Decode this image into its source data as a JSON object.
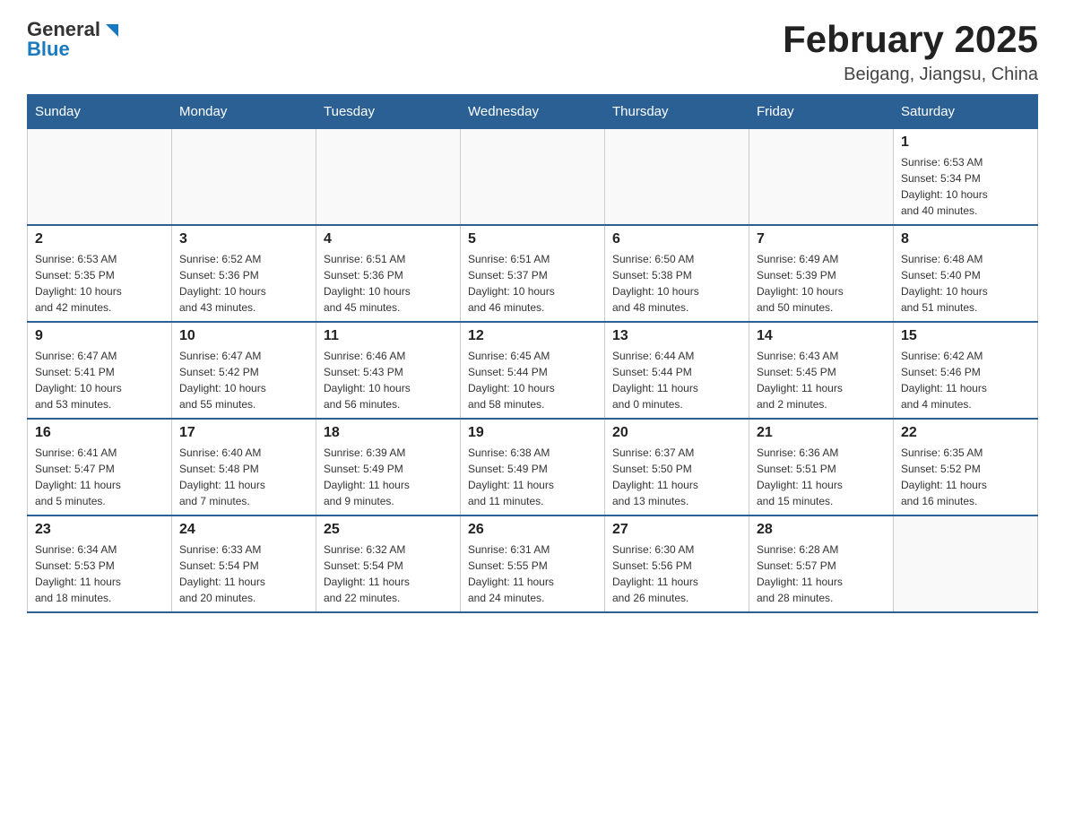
{
  "header": {
    "logo_general": "General",
    "logo_blue": "Blue",
    "month_title": "February 2025",
    "location": "Beigang, Jiangsu, China"
  },
  "days_of_week": [
    "Sunday",
    "Monday",
    "Tuesday",
    "Wednesday",
    "Thursday",
    "Friday",
    "Saturday"
  ],
  "weeks": [
    {
      "days": [
        {
          "num": "",
          "info": ""
        },
        {
          "num": "",
          "info": ""
        },
        {
          "num": "",
          "info": ""
        },
        {
          "num": "",
          "info": ""
        },
        {
          "num": "",
          "info": ""
        },
        {
          "num": "",
          "info": ""
        },
        {
          "num": "1",
          "info": "Sunrise: 6:53 AM\nSunset: 5:34 PM\nDaylight: 10 hours\nand 40 minutes."
        }
      ]
    },
    {
      "days": [
        {
          "num": "2",
          "info": "Sunrise: 6:53 AM\nSunset: 5:35 PM\nDaylight: 10 hours\nand 42 minutes."
        },
        {
          "num": "3",
          "info": "Sunrise: 6:52 AM\nSunset: 5:36 PM\nDaylight: 10 hours\nand 43 minutes."
        },
        {
          "num": "4",
          "info": "Sunrise: 6:51 AM\nSunset: 5:36 PM\nDaylight: 10 hours\nand 45 minutes."
        },
        {
          "num": "5",
          "info": "Sunrise: 6:51 AM\nSunset: 5:37 PM\nDaylight: 10 hours\nand 46 minutes."
        },
        {
          "num": "6",
          "info": "Sunrise: 6:50 AM\nSunset: 5:38 PM\nDaylight: 10 hours\nand 48 minutes."
        },
        {
          "num": "7",
          "info": "Sunrise: 6:49 AM\nSunset: 5:39 PM\nDaylight: 10 hours\nand 50 minutes."
        },
        {
          "num": "8",
          "info": "Sunrise: 6:48 AM\nSunset: 5:40 PM\nDaylight: 10 hours\nand 51 minutes."
        }
      ]
    },
    {
      "days": [
        {
          "num": "9",
          "info": "Sunrise: 6:47 AM\nSunset: 5:41 PM\nDaylight: 10 hours\nand 53 minutes."
        },
        {
          "num": "10",
          "info": "Sunrise: 6:47 AM\nSunset: 5:42 PM\nDaylight: 10 hours\nand 55 minutes."
        },
        {
          "num": "11",
          "info": "Sunrise: 6:46 AM\nSunset: 5:43 PM\nDaylight: 10 hours\nand 56 minutes."
        },
        {
          "num": "12",
          "info": "Sunrise: 6:45 AM\nSunset: 5:44 PM\nDaylight: 10 hours\nand 58 minutes."
        },
        {
          "num": "13",
          "info": "Sunrise: 6:44 AM\nSunset: 5:44 PM\nDaylight: 11 hours\nand 0 minutes."
        },
        {
          "num": "14",
          "info": "Sunrise: 6:43 AM\nSunset: 5:45 PM\nDaylight: 11 hours\nand 2 minutes."
        },
        {
          "num": "15",
          "info": "Sunrise: 6:42 AM\nSunset: 5:46 PM\nDaylight: 11 hours\nand 4 minutes."
        }
      ]
    },
    {
      "days": [
        {
          "num": "16",
          "info": "Sunrise: 6:41 AM\nSunset: 5:47 PM\nDaylight: 11 hours\nand 5 minutes."
        },
        {
          "num": "17",
          "info": "Sunrise: 6:40 AM\nSunset: 5:48 PM\nDaylight: 11 hours\nand 7 minutes."
        },
        {
          "num": "18",
          "info": "Sunrise: 6:39 AM\nSunset: 5:49 PM\nDaylight: 11 hours\nand 9 minutes."
        },
        {
          "num": "19",
          "info": "Sunrise: 6:38 AM\nSunset: 5:49 PM\nDaylight: 11 hours\nand 11 minutes."
        },
        {
          "num": "20",
          "info": "Sunrise: 6:37 AM\nSunset: 5:50 PM\nDaylight: 11 hours\nand 13 minutes."
        },
        {
          "num": "21",
          "info": "Sunrise: 6:36 AM\nSunset: 5:51 PM\nDaylight: 11 hours\nand 15 minutes."
        },
        {
          "num": "22",
          "info": "Sunrise: 6:35 AM\nSunset: 5:52 PM\nDaylight: 11 hours\nand 16 minutes."
        }
      ]
    },
    {
      "days": [
        {
          "num": "23",
          "info": "Sunrise: 6:34 AM\nSunset: 5:53 PM\nDaylight: 11 hours\nand 18 minutes."
        },
        {
          "num": "24",
          "info": "Sunrise: 6:33 AM\nSunset: 5:54 PM\nDaylight: 11 hours\nand 20 minutes."
        },
        {
          "num": "25",
          "info": "Sunrise: 6:32 AM\nSunset: 5:54 PM\nDaylight: 11 hours\nand 22 minutes."
        },
        {
          "num": "26",
          "info": "Sunrise: 6:31 AM\nSunset: 5:55 PM\nDaylight: 11 hours\nand 24 minutes."
        },
        {
          "num": "27",
          "info": "Sunrise: 6:30 AM\nSunset: 5:56 PM\nDaylight: 11 hours\nand 26 minutes."
        },
        {
          "num": "28",
          "info": "Sunrise: 6:28 AM\nSunset: 5:57 PM\nDaylight: 11 hours\nand 28 minutes."
        },
        {
          "num": "",
          "info": ""
        }
      ]
    }
  ]
}
